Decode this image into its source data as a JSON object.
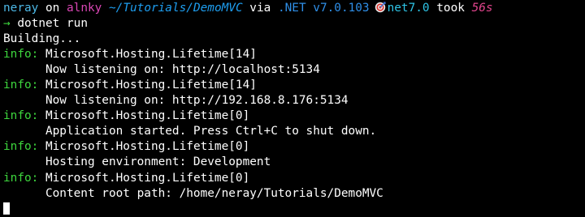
{
  "prompt": {
    "user": "neray",
    "on_word": "on",
    "host": "alnky",
    "path": "~/Tutorials/DemoMVC",
    "via_word": "via",
    "dotnet_version": ".NET v7.0.103",
    "framework": "net7.0",
    "took_word": "took",
    "duration": "56s"
  },
  "command": {
    "arrow": "→",
    "text": "dotnet run"
  },
  "output": {
    "building": "Building...",
    "entries": [
      {
        "level": "info:",
        "source": "Microsoft.Hosting.Lifetime[14]",
        "message": "Now listening on: http://localhost:5134"
      },
      {
        "level": "info:",
        "source": "Microsoft.Hosting.Lifetime[14]",
        "message": "Now listening on: http://192.168.8.176:5134"
      },
      {
        "level": "info:",
        "source": "Microsoft.Hosting.Lifetime[0]",
        "message": "Application started. Press Ctrl+C to shut down."
      },
      {
        "level": "info:",
        "source": "Microsoft.Hosting.Lifetime[0]",
        "message": "Hosting environment: Development"
      },
      {
        "level": "info:",
        "source": "Microsoft.Hosting.Lifetime[0]",
        "message": "Content root path: /home/neray/Tutorials/DemoMVC"
      }
    ]
  },
  "icons": {
    "framework_icon": "target-icon"
  },
  "colors": {
    "background": "#000000",
    "text": "#ffffff",
    "user": "#4db8e6",
    "host": "#d946b4",
    "path": "#1e9ef0",
    "info": "#3dd63d",
    "duration": "#e0448c"
  }
}
